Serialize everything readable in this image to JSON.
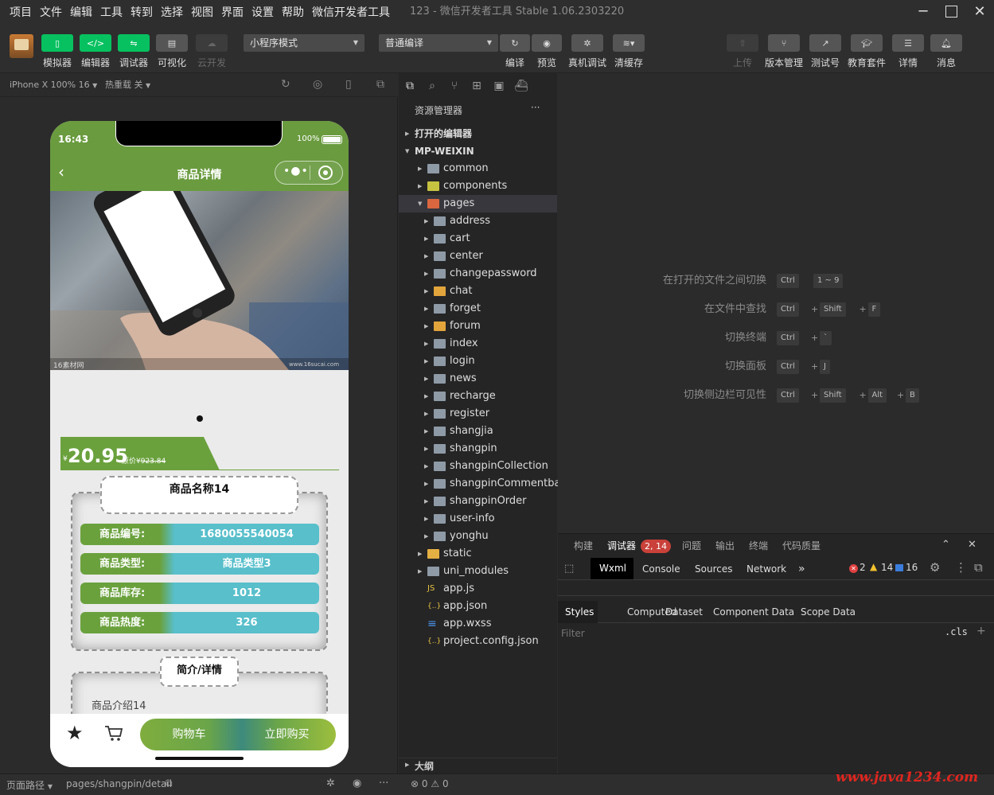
{
  "menu": [
    "项目",
    "文件",
    "编辑",
    "工具",
    "转到",
    "选择",
    "视图",
    "界面",
    "设置",
    "帮助",
    "微信开发者工具"
  ],
  "window_title": "123 - 微信开发者工具 Stable 1.06.2303220",
  "toolbar": {
    "simulator": "模拟器",
    "editor": "编辑器",
    "debugger": "调试器",
    "visual": "可视化",
    "cloud": "云开发",
    "mode_select": "小程序模式",
    "compile_select": "普通编译",
    "compile": "编译",
    "preview": "预览",
    "remote_debug": "真机调试",
    "clear_cache": "清缓存",
    "upload": "上传",
    "version": "版本管理",
    "test_account": "测试号",
    "edu": "教育套件",
    "details": "详情",
    "messages": "消息"
  },
  "sim_bar": {
    "device": "iPhone X 100% 16",
    "hot_reload": "热重载 关"
  },
  "phone": {
    "time": "16:43",
    "battery": "100%",
    "nav_title": "商品详情",
    "watermark_left": "16素材网",
    "watermark_right": "www.16sucai.com",
    "price_symbol": "¥",
    "price": "20.95",
    "orig_label": "原价¥",
    "orig_price": "923.84",
    "product_name": "商品名称14",
    "info_rows": [
      {
        "key": "商品编号:",
        "value": "1680055540054"
      },
      {
        "key": "商品类型:",
        "value": "商品类型3"
      },
      {
        "key": "商品库存:",
        "value": "1012"
      },
      {
        "key": "商品热度:",
        "value": "326"
      }
    ],
    "detail_title": "简介/详情",
    "detail_text": "商品介绍14",
    "cart_button": "购物车",
    "buy_button": "立即购买"
  },
  "explorer": {
    "title": "资源管理器",
    "more": "···",
    "open_editors": "打开的编辑器",
    "root": "MP-WEIXIN",
    "items": [
      {
        "name": "common",
        "depth": 1,
        "type": "folder",
        "arrow": "▶"
      },
      {
        "name": "components",
        "depth": 1,
        "type": "folder-special",
        "arrow": "▶"
      },
      {
        "name": "pages",
        "depth": 1,
        "type": "folder-open",
        "arrow": "▼"
      },
      {
        "name": "address",
        "depth": 2,
        "type": "folder",
        "arrow": "▶"
      },
      {
        "name": "cart",
        "depth": 2,
        "type": "folder",
        "arrow": "▶"
      },
      {
        "name": "center",
        "depth": 2,
        "type": "folder",
        "arrow": "▶"
      },
      {
        "name": "changepassword",
        "depth": 2,
        "type": "folder",
        "arrow": "▶"
      },
      {
        "name": "chat",
        "depth": 2,
        "type": "folder-chat",
        "arrow": "▶"
      },
      {
        "name": "forget",
        "depth": 2,
        "type": "folder",
        "arrow": "▶"
      },
      {
        "name": "forum",
        "depth": 2,
        "type": "folder-chat",
        "arrow": "▶"
      },
      {
        "name": "index",
        "depth": 2,
        "type": "folder",
        "arrow": "▶"
      },
      {
        "name": "login",
        "depth": 2,
        "type": "folder",
        "arrow": "▶"
      },
      {
        "name": "news",
        "depth": 2,
        "type": "folder",
        "arrow": "▶"
      },
      {
        "name": "recharge",
        "depth": 2,
        "type": "folder",
        "arrow": "▶"
      },
      {
        "name": "register",
        "depth": 2,
        "type": "folder",
        "arrow": "▶"
      },
      {
        "name": "shangjia",
        "depth": 2,
        "type": "folder",
        "arrow": "▶"
      },
      {
        "name": "shangpin",
        "depth": 2,
        "type": "folder",
        "arrow": "▶"
      },
      {
        "name": "shangpinCollection",
        "depth": 2,
        "type": "folder",
        "arrow": "▶"
      },
      {
        "name": "shangpinCommentba...",
        "depth": 2,
        "type": "folder",
        "arrow": "▶"
      },
      {
        "name": "shangpinOrder",
        "depth": 2,
        "type": "folder",
        "arrow": "▶"
      },
      {
        "name": "user-info",
        "depth": 2,
        "type": "folder",
        "arrow": "▶"
      },
      {
        "name": "yonghu",
        "depth": 2,
        "type": "folder",
        "arrow": "▶"
      },
      {
        "name": "static",
        "depth": 1,
        "type": "folder-static",
        "arrow": "▶"
      },
      {
        "name": "uni_modules",
        "depth": 1,
        "type": "folder",
        "arrow": "▶"
      },
      {
        "name": "app.js",
        "depth": 1,
        "type": "file-js",
        "arrow": ""
      },
      {
        "name": "app.json",
        "depth": 1,
        "type": "file-json",
        "arrow": ""
      },
      {
        "name": "app.wxss",
        "depth": 1,
        "type": "file-wxss",
        "arrow": ""
      },
      {
        "name": "project.config.json",
        "depth": 1,
        "type": "file-json",
        "arrow": ""
      }
    ],
    "outline": "大纲"
  },
  "shortcuts": [
    {
      "label": "在打开的文件之间切换",
      "keys": [
        "Ctrl",
        "1 ~ 9"
      ],
      "joined": false
    },
    {
      "label": "在文件中查找",
      "keys": [
        "Ctrl",
        "Shift",
        "F"
      ],
      "joined": true
    },
    {
      "label": "切换终端",
      "keys": [
        "Ctrl",
        "`"
      ],
      "joined": true
    },
    {
      "label": "切换面板",
      "keys": [
        "Ctrl",
        "J"
      ],
      "joined": true
    },
    {
      "label": "切换侧边栏可见性",
      "keys": [
        "Ctrl",
        "Shift",
        "Alt",
        "B"
      ],
      "joined": true
    }
  ],
  "devtools": {
    "top_tabs": [
      "构建",
      "调试器",
      "问题",
      "输出",
      "终端",
      "代码质量"
    ],
    "debugger_badge": "2, 14",
    "tabs": [
      "Wxml",
      "Console",
      "Sources",
      "Network"
    ],
    "more": "»",
    "errors": "2",
    "warnings": "14",
    "infos": "16",
    "style_tabs": [
      "Styles",
      "Computed",
      "Dataset",
      "Component Data",
      "Scope Data"
    ],
    "filter_placeholder": "Filter",
    "cls": ".cls",
    "plus": "+"
  },
  "status": {
    "page_path_label": "页面路径",
    "page_path": "pages/shangpin/detail",
    "errors": "0",
    "warnings": "0",
    "watermark": "www.java1234.com"
  },
  "colors": {
    "green": "#07c160",
    "nav_green": "#6a9b3f",
    "teal": "#58bfcb",
    "badge_red": "#c9413a",
    "watermark_red": "#e0261f"
  }
}
